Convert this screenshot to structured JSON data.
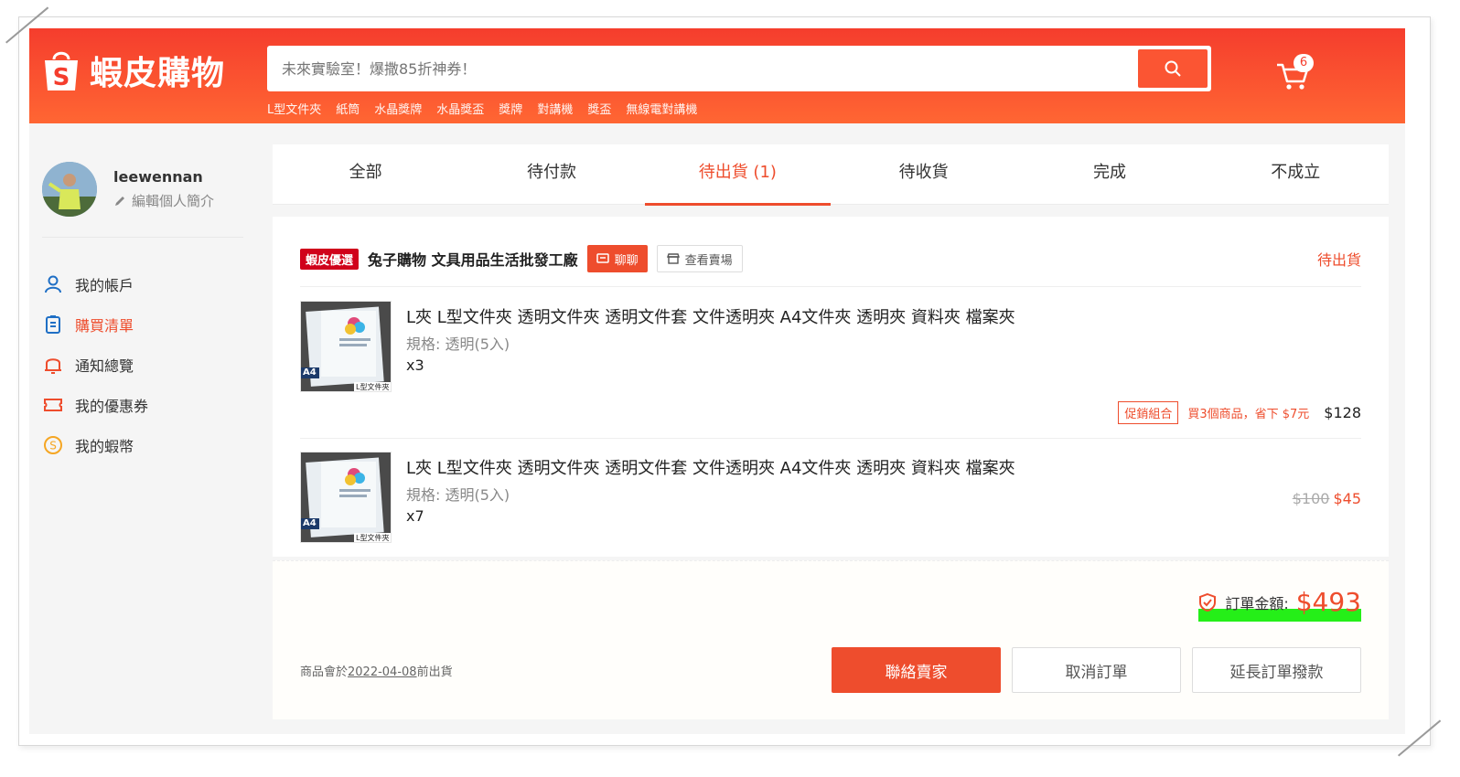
{
  "header": {
    "logo_text": "蝦皮購物",
    "search_placeholder": "未來實驗室！爆撒85折神券！",
    "hot_words": [
      "L型文件夾",
      "紙筒",
      "水晶獎牌",
      "水晶獎盃",
      "獎牌",
      "對講機",
      "獎盃",
      "無線電對講機"
    ],
    "cart_count": "6",
    "brand_color": "#f53d2d"
  },
  "profile": {
    "username": "leewennan",
    "edit_label": "編輯個人簡介"
  },
  "sidebar": {
    "items": [
      {
        "label": "我的帳戶",
        "icon": "user-icon"
      },
      {
        "label": "購買清單",
        "icon": "clipboard-icon"
      },
      {
        "label": "通知總覽",
        "icon": "bell-icon"
      },
      {
        "label": "我的優惠券",
        "icon": "ticket-icon"
      },
      {
        "label": "我的蝦幣",
        "icon": "coin-icon"
      }
    ]
  },
  "tabs": [
    "全部",
    "待付款",
    "待出貨 (1)",
    "待收貨",
    "完成",
    "不成立"
  ],
  "order": {
    "badge": "蝦皮優選",
    "shop_name": "兔子購物 文具用品生活批發工廠",
    "chat_label": "聊聊",
    "view_shop_label": "查看賣場",
    "status": "待出貨",
    "items": [
      {
        "title": "L夾 L型文件夾 透明文件夾 透明文件套 文件透明夾 A4文件夾 透明夾 資料夾 檔案夾",
        "spec": "規格: 透明(5入)",
        "qty": "x3",
        "promo_tag": "促銷組合",
        "promo_desc": "買3個商品，省下 $7元",
        "price": "$128"
      },
      {
        "title": "L夾 L型文件夾 透明文件夾 透明文件套 文件透明夾 A4文件夾 透明夾 資料夾 檔案夾",
        "spec": "規格: 透明(5入)",
        "qty": "x7",
        "price_old": "$100",
        "price": "$45"
      }
    ],
    "thumb_labels": {
      "a4": "A4",
      "caption": "L型文件夾"
    }
  },
  "summary": {
    "total_label": "訂單金額:",
    "total_value": "$493",
    "ship_prefix": "商品會於",
    "ship_date": "2022-04-08",
    "ship_suffix": "前出貨",
    "btn_contact": "聯絡賣家",
    "btn_cancel": "取消訂單",
    "btn_extend": "延長訂單撥款"
  }
}
